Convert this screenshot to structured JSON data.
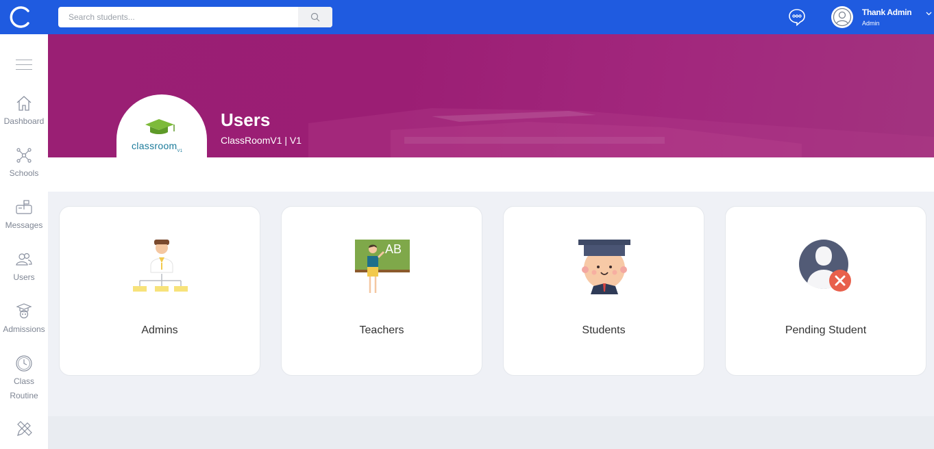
{
  "header": {
    "search_placeholder": "Search students...",
    "user_name": "Thank Admin",
    "user_role": "Admin"
  },
  "sidebar": {
    "items": [
      {
        "label": "Dashboard",
        "icon": "home-icon"
      },
      {
        "label": "Schools",
        "icon": "network-icon"
      },
      {
        "label": "Messages",
        "icon": "mailbox-icon"
      },
      {
        "label": "Users",
        "icon": "users-icon"
      },
      {
        "label": "Admissions",
        "icon": "graduate-icon"
      },
      {
        "label": "Class",
        "label2": "Routine",
        "icon": "clock-icon"
      },
      {
        "label": "",
        "icon": "pencil-ruler-icon"
      }
    ]
  },
  "banner": {
    "title": "Users",
    "subtitle": "ClassRoomV1 | V1",
    "brand_logo_text": "classroom",
    "brand_logo_suffix": "V1"
  },
  "cards": [
    {
      "label": "Admins",
      "icon": "admin-hierarchy-icon"
    },
    {
      "label": "Teachers",
      "icon": "teacher-blackboard-icon"
    },
    {
      "label": "Students",
      "icon": "student-graduate-icon"
    },
    {
      "label": "Pending Student",
      "icon": "pending-user-icon"
    }
  ],
  "colors": {
    "topbar": "#1f5be0",
    "banner": "#9b1e74",
    "background": "#eff1f6",
    "pending_badge": "#e8604c"
  }
}
